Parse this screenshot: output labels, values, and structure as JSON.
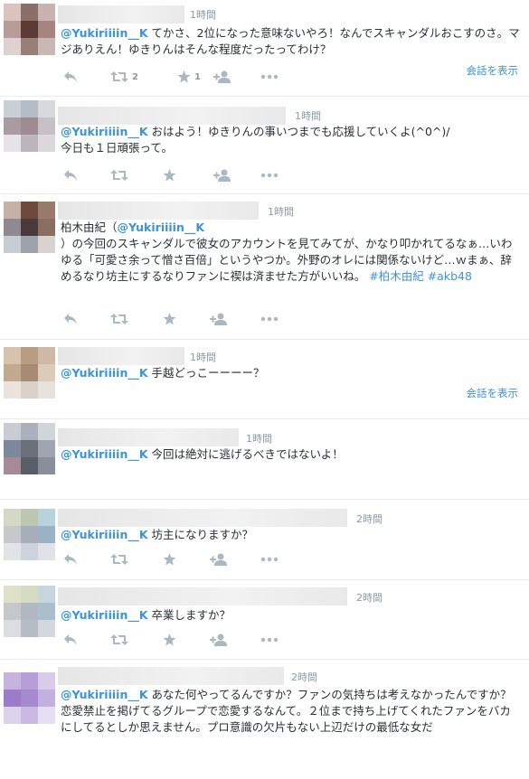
{
  "colors": {
    "link": "#3b94d9",
    "text": "#292f33",
    "muted": "#8899a6",
    "icon": "#aab8c2",
    "divider": "#e6ecf0"
  },
  "icons": {
    "reply": "reply-icon",
    "retweet": "retweet-icon",
    "favorite": "star-icon",
    "follow": "follow-user-icon",
    "more": "more-icon"
  },
  "tweets": [
    {
      "time": "1時間",
      "mention": "@Yukiriiiin__K",
      "text_rest": " てかさ、2位になった意味ないやろ！なんでスキャンダルおこすのさ。マジありえん！ゆきりんはそんな程度だったってわけ？",
      "retweets": "2",
      "favorites": "1",
      "conversation": "会話を表示"
    },
    {
      "time": "1時間",
      "mention": "@Yukiriiiin__K",
      "text_rest": " おはよう！ゆきりんの事いつまでも応援していくよ(^0^)/\n今日も１日頑張って。"
    },
    {
      "time": "1時間",
      "text_pre": "柏木由紀（",
      "mention": "@Yukiriiiin__K",
      "text_rest": "\n）の今回のスキャンダルで彼女のアカウントを見てみてが、かなり叩かれてるなぁ…いわゆる「可愛さ余って憎さ百倍」というやつか。外野のオレには関係ないけど…ｗまぁ、辞めるなり坊主にするなりファンに禊は済ませた方がいいね。",
      "hashtags": "#柏木由紀 #akb48"
    },
    {
      "time": "1時間",
      "mention": "@Yukiriiiin__K",
      "text_rest": " 手越どっこーーーー？",
      "conversation": "会話を表示"
    },
    {
      "time": "1時間",
      "mention": "@Yukiriiiin__K",
      "text_rest": " 今回は絶対に逃げるべきではないよ！"
    },
    {
      "time": "2時間",
      "mention": "@Yukiriiiin__K",
      "text_rest": " 坊主になりますか？"
    },
    {
      "time": "2時間",
      "mention": "@Yukiriiiin__K",
      "text_rest": " 卒業しますか？"
    },
    {
      "time": "2時間",
      "mention": "@Yukiriiiin__K",
      "text_rest": " あなた何やってるんですか？ファンの気持ちは考えなかったんですか？\n恋愛禁止を掲げてるグループで恋愛するなんて。２位まで持ち上げてくれたファンをバカにしてるとしか思えません。プロ意識の欠片もない上辺だけの最低な女だ"
    }
  ]
}
